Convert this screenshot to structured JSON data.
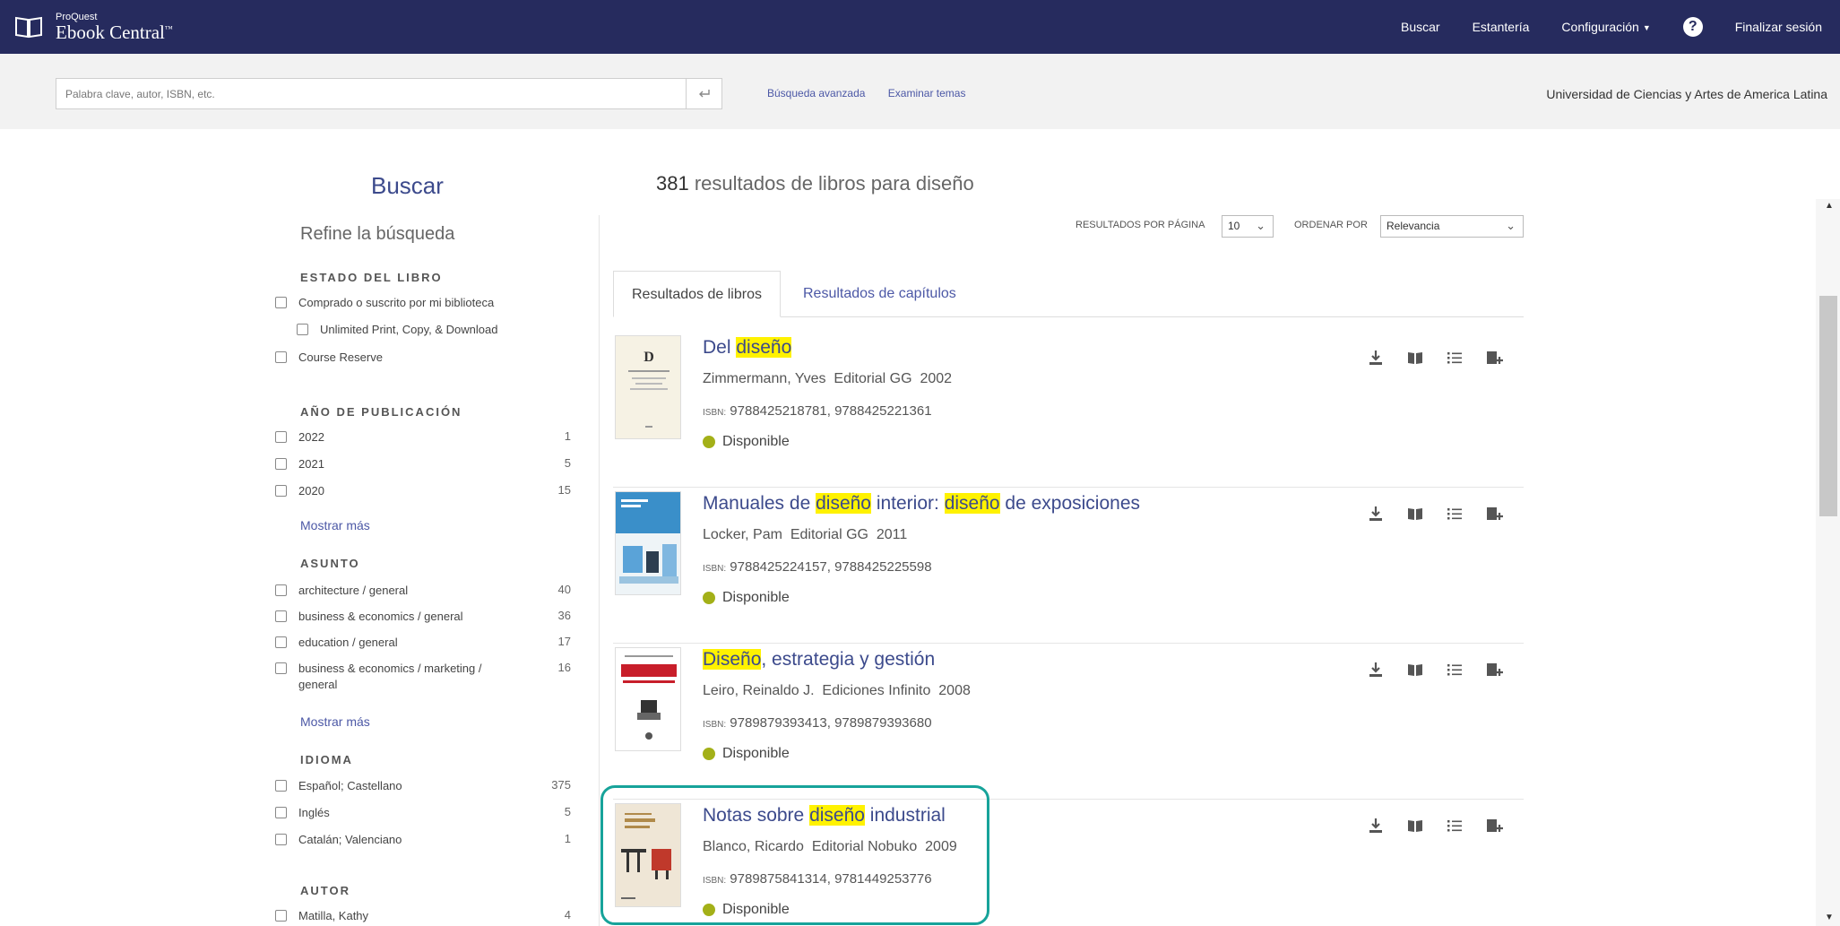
{
  "app": {
    "logo_small": "ProQuest",
    "logo_big": "Ebook Central",
    "logo_tm": "™"
  },
  "nav": {
    "buscar": "Buscar",
    "estanteria": "Estantería",
    "configuracion": "Configuración",
    "help": "?",
    "logout": "Finalizar sesión"
  },
  "search": {
    "placeholder": "Palabra clave, autor, ISBN, etc.",
    "advanced": "Búsqueda avanzada",
    "browse": "Examinar temas",
    "institution": "Universidad de Ciencias y Artes de America Latina"
  },
  "sidebar": {
    "heading": "Buscar",
    "refine": "Refine la búsqueda",
    "estado_head": "ESTADO DEL LIBRO",
    "estado": [
      {
        "label": "Comprado o suscrito por mi biblioteca"
      },
      {
        "label": "Unlimited Print, Copy, & Download"
      },
      {
        "label": "Course Reserve"
      }
    ],
    "anio_head": "AÑO DE PUBLICACIÓN",
    "anio": [
      {
        "label": "2022",
        "count": "1"
      },
      {
        "label": "2021",
        "count": "5"
      },
      {
        "label": "2020",
        "count": "15"
      }
    ],
    "more_label": "Mostrar más",
    "asunto_head": "ASUNTO",
    "asunto": [
      {
        "label": "architecture / general",
        "count": "40"
      },
      {
        "label": "business & economics / general",
        "count": "36"
      },
      {
        "label": "education / general",
        "count": "17"
      },
      {
        "label": "business & economics / marketing / general",
        "count": "16"
      }
    ],
    "idioma_head": "IDIOMA",
    "idioma": [
      {
        "label": "Español; Castellano",
        "count": "375"
      },
      {
        "label": "Inglés",
        "count": "5"
      },
      {
        "label": "Catalán; Valenciano",
        "count": "1"
      }
    ],
    "autor_head": "AUTOR",
    "autor": [
      {
        "label": "Matilla, Kathy",
        "count": "4"
      }
    ]
  },
  "results": {
    "count": "381",
    "title_rest": "resultados de libros para diseño",
    "per_page_label": "RESULTADOS POR PÁGINA",
    "per_page_value": "10",
    "order_label": "ORDENAR POR",
    "order_value": "Relevancia",
    "tabs": [
      "Resultados de libros",
      "Resultados de capítulos"
    ],
    "isbn_label": "ISBN:",
    "available": "Disponible",
    "items": [
      {
        "title_parts": [
          "Del ",
          "diseño",
          ""
        ],
        "authors": "Zimmermann, Yves",
        "publisher": "Editorial GG",
        "year": "2002",
        "isbn": "9788425218781, 9788425221361"
      },
      {
        "title_parts": [
          "Manuales de ",
          "diseño",
          " interior: ",
          "diseño",
          " de exposiciones"
        ],
        "authors": "Locker, Pam",
        "publisher": "Editorial GG",
        "year": "2011",
        "isbn": "9788425224157, 9788425225598"
      },
      {
        "title_parts": [
          "",
          "Diseño",
          ", estrategia y gestión"
        ],
        "authors": "Leiro, Reinaldo J.",
        "publisher": "Ediciones Infinito",
        "year": "2008",
        "isbn": "9789879393413, 9789879393680"
      },
      {
        "title_parts": [
          "Notas sobre ",
          "diseño",
          " industrial"
        ],
        "authors": "Blanco, Ricardo",
        "publisher": "Editorial Nobuko",
        "year": "2009",
        "isbn": "9789875841314, 9781449253776"
      }
    ]
  },
  "colors": {
    "navbar": "#262b5e",
    "link": "#4c58a6",
    "highlight": "#fff200",
    "available_dot": "#a3b018",
    "callout": "#17a39a"
  }
}
